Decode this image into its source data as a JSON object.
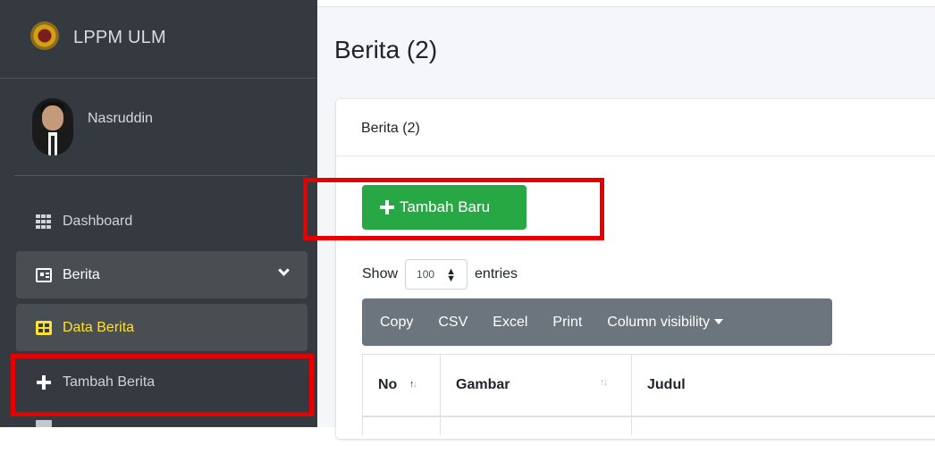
{
  "sidebar": {
    "brand": "LPPM ULM",
    "user_name": "Nasruddin",
    "items": [
      {
        "label": "Dashboard",
        "icon": "grid-icon"
      },
      {
        "label": "Berita",
        "icon": "newspaper-icon"
      },
      {
        "label": "Data Berita",
        "icon": "table-icon"
      },
      {
        "label": "Tambah Berita",
        "icon": "plus-icon"
      }
    ]
  },
  "page": {
    "title": "Berita (2)",
    "card_title": "Berita (2)",
    "add_button": "Tambah Baru",
    "show_label": "Show",
    "entries_value": "100",
    "entries_label": "entries",
    "export_buttons": [
      "Copy",
      "CSV",
      "Excel",
      "Print",
      "Column visibility"
    ],
    "table_headers": [
      "No",
      "Gambar",
      "Judul"
    ]
  },
  "colors": {
    "sidebar_bg": "#343a40",
    "active_item_text": "#ffe033",
    "add_button_bg": "#28a745",
    "highlight_box": "#e60000"
  }
}
